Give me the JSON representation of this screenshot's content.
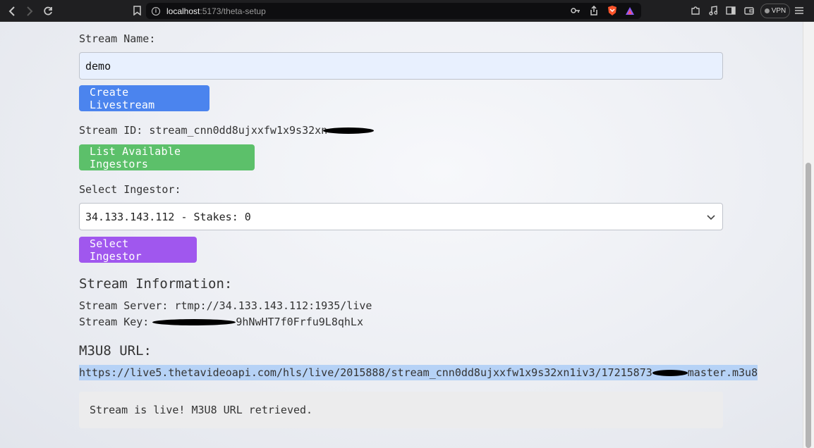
{
  "browser": {
    "back_icon": "chevron-left-icon",
    "forward_icon": "chevron-right-icon",
    "reload_icon": "reload-icon",
    "url_host": "localhost",
    "url_path": ":5173/theta-setup",
    "vpn_label": "VPN"
  },
  "form": {
    "stream_name_label": "Stream Name:",
    "stream_name_value": "demo",
    "create_button": "Create Livestream",
    "stream_id_text": "Stream ID: stream_cnn0dd8ujxxfw1x9s32xn",
    "list_ingestors_button": "List Available Ingestors",
    "select_ingestor_label": "Select Ingestor:",
    "ingestor_selected": "34.133.143.112 - Stakes: 0",
    "select_ingestor_button": "Select Ingestor"
  },
  "stream_info": {
    "heading": "Stream Information:",
    "server_text": "Stream Server: rtmp://34.133.143.112:1935/live",
    "key_label": "Stream Key:",
    "key_value_visible": "9hNwHT7f0Frfu9L8qhLx"
  },
  "m3u8": {
    "heading": "M3U8 URL:",
    "url_prefix": "https://live5.thetavideoapi.com/hls/live/2015888/stream_cnn0dd8ujxxfw1x9s32xn1iv3/17215873",
    "url_suffix": "master.m3u8"
  },
  "status": {
    "message": "Stream is live! M3U8 URL retrieved."
  },
  "colors": {
    "create_button": "#4b84ee",
    "list_button": "#5cc06a",
    "select_button": "#a057ee",
    "url_highlight": "#b6d2f6"
  }
}
